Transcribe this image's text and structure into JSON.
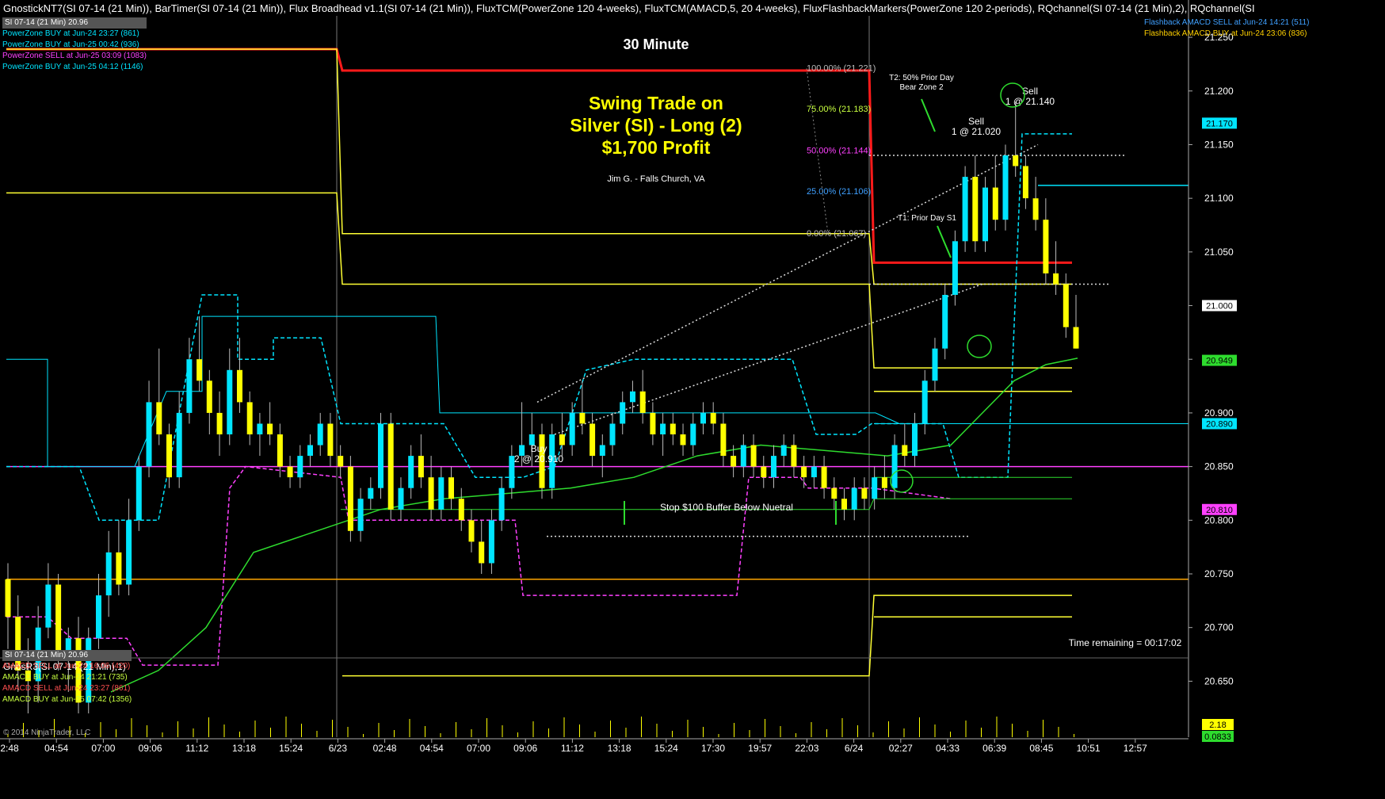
{
  "header": {
    "title": "GnostickNT7(SI 07-14 (21 Min)), BarTimer(SI 07-14 (21 Min)), Flux Broadhead v1.1(SI 07-14 (21 Min)), FluxTCM(PowerZone 120 4-weeks), FluxTCM(AMACD,5, 20 4-weeks), FluxFlashbackMarkers(PowerZone 120 2-periods), RQchannel(SI 07-14 (21 Min),2), RQchannel(SI"
  },
  "legend_top_left": [
    {
      "text": "SI 07-14 (21 Min) 20.96",
      "color": "#ffffff",
      "boxed": true
    },
    {
      "text": "PowerZone BUY at Jun-24 23:27 (861)",
      "color": "#00e5ff"
    },
    {
      "text": "PowerZone BUY at Jun-25 00:42 (936)",
      "color": "#00e5ff"
    },
    {
      "text": "PowerZone SELL at Jun-25 03:09 (1083)",
      "color": "#ff40ff"
    },
    {
      "text": "PowerZone BUY at Jun-25 04:12 (1146)",
      "color": "#00e5ff"
    }
  ],
  "legend_top_right": [
    {
      "text": "Flashback AMACD SELL at Jun-24 14:21 (511)",
      "color": "#3fa0ff"
    },
    {
      "text": "Flashback AMACD BUY at Jun-24 23:06 (836)",
      "color": "#ffd000"
    }
  ],
  "legend_bottom_left": [
    {
      "text": "SI 07-14 (21 Min) 20.96",
      "color": "#ffffff",
      "boxed": true
    },
    {
      "text": "AMACD SELL at Jun-24 16:06 (420)",
      "color": "#ff5050"
    },
    {
      "text": "AMACD BUY at Jun-24 21:21 (735)",
      "color": "#c8ff40"
    },
    {
      "text": "AMACD SELL at Jun-24 23:27 (861)",
      "color": "#ff5050"
    },
    {
      "text": "AMACD BUY at Jun-25 07:42 (1356)",
      "color": "#c8ff40"
    }
  ],
  "annotations": {
    "timeframe": "30 Minute",
    "headline": [
      "Swing Trade on",
      "Silver (SI) - Long (2)",
      "$1,700 Profit"
    ],
    "author": "Jim G. - Falls Church, VA",
    "fib": [
      {
        "label": "100.00% (21.221)",
        "value": 21.221,
        "color": "#bdbdbd"
      },
      {
        "label": "75.00% (21.183)",
        "value": 21.183,
        "color": "#c8ff40"
      },
      {
        "label": "50.00% (21.144)",
        "value": 21.144,
        "color": "#ff40ff"
      },
      {
        "label": "25.00% (21.106)",
        "value": 21.106,
        "color": "#3fa0ff"
      },
      {
        "label": "0.00% (21.067)",
        "value": 21.067,
        "color": "#bdbdbd"
      }
    ],
    "t2": [
      "T2: 50% Prior Day",
      "Bear Zone 2"
    ],
    "t1": "T1: Prior Day S1",
    "sell1": [
      "Sell",
      "1 @ 21.020"
    ],
    "sell2": [
      "Sell",
      "1 @ 21.140"
    ],
    "buy": [
      "Buy",
      "2 @ 20.910"
    ],
    "stop": "Stop $100 Buffer Below Nuetral",
    "time_remaining": "Time remaining = 00:17:02"
  },
  "price_axis": {
    "ticks": [
      "21.250",
      "21.200",
      "21.150",
      "21.100",
      "21.050",
      "21.000",
      "20.950",
      "20.900",
      "20.850",
      "20.800",
      "20.750",
      "20.700",
      "20.650"
    ],
    "tags": [
      {
        "label": "21.170",
        "value": 21.17,
        "color": "#00e5ff"
      },
      {
        "label": "21.000",
        "value": 21.0,
        "color": "#ffffff"
      },
      {
        "label": "20.949",
        "value": 20.949,
        "color": "#2edc2e"
      },
      {
        "label": "20.890",
        "value": 20.89,
        "color": "#00e5ff"
      },
      {
        "label": "20.810",
        "value": 20.81,
        "color": "#ff40ff"
      }
    ]
  },
  "time_axis": {
    "ticks": [
      "2:48",
      "04:54",
      "07:00",
      "09:06",
      "11:12",
      "13:18",
      "15:24",
      "6/23",
      "02:48",
      "04:54",
      "07:00",
      "09:06",
      "11:12",
      "13:18",
      "15:24",
      "17:30",
      "19:57",
      "22:03",
      "6/24",
      "02:27",
      "04:33",
      "06:39",
      "08:45",
      "10:51",
      "12:57"
    ]
  },
  "sub_panel": {
    "title": "GnosR3(SI 07-14 (21 Min),1)",
    "tags": [
      {
        "label": "2.18",
        "color": "#ffff00"
      },
      {
        "label": "0.0833",
        "color": "#2edc2e"
      }
    ]
  },
  "copyright": "© 2014 NinjaTrader, LLC",
  "colors": {
    "up": "#00e5ff",
    "down": "#ffff00",
    "red_level": "#ff1a1a",
    "yellow_level": "#ffff33",
    "orange_level": "#ffa500",
    "ma_green": "#2edc2e",
    "magenta": "#ff40ff",
    "cyan": "#00e5ff"
  },
  "chart_data": {
    "type": "candlestick",
    "symbol": "SI 07-14 (21 Min)",
    "ylim": [
      20.62,
      21.27
    ],
    "bars": [
      [
        20.745,
        20.76,
        20.68,
        20.71
      ],
      [
        20.71,
        20.73,
        20.64,
        20.66
      ],
      [
        20.66,
        20.69,
        20.62,
        20.65
      ],
      [
        20.65,
        20.72,
        20.63,
        20.7
      ],
      [
        20.7,
        20.76,
        20.69,
        20.74
      ],
      [
        20.74,
        20.75,
        20.66,
        20.67
      ],
      [
        20.67,
        20.7,
        20.64,
        20.69
      ],
      [
        20.69,
        20.71,
        20.62,
        20.63
      ],
      [
        20.63,
        20.7,
        20.62,
        20.69
      ],
      [
        20.69,
        20.75,
        20.68,
        20.73
      ],
      [
        20.73,
        20.79,
        20.71,
        20.77
      ],
      [
        20.77,
        20.8,
        20.73,
        20.74
      ],
      [
        20.74,
        20.82,
        20.73,
        20.8
      ],
      [
        20.8,
        20.86,
        20.79,
        20.85
      ],
      [
        20.85,
        20.93,
        20.84,
        20.91
      ],
      [
        20.91,
        20.96,
        20.87,
        20.88
      ],
      [
        20.88,
        20.89,
        20.83,
        20.84
      ],
      [
        20.84,
        20.92,
        20.83,
        20.9
      ],
      [
        20.9,
        20.97,
        20.89,
        20.95
      ],
      [
        20.95,
        20.99,
        20.92,
        20.93
      ],
      [
        20.93,
        20.94,
        20.88,
        20.9
      ],
      [
        20.9,
        20.92,
        20.86,
        20.88
      ],
      [
        20.88,
        20.96,
        20.87,
        20.94
      ],
      [
        20.94,
        20.97,
        20.9,
        20.91
      ],
      [
        20.91,
        20.92,
        20.87,
        20.88
      ],
      [
        20.88,
        20.9,
        20.86,
        20.89
      ],
      [
        20.89,
        20.91,
        20.87,
        20.88
      ],
      [
        20.88,
        20.89,
        20.84,
        20.85
      ],
      [
        20.85,
        20.86,
        20.83,
        20.84
      ],
      [
        20.84,
        20.87,
        20.83,
        20.86
      ],
      [
        20.86,
        20.88,
        20.85,
        20.87
      ],
      [
        20.87,
        20.9,
        20.86,
        20.89
      ],
      [
        20.89,
        20.9,
        20.85,
        20.86
      ],
      [
        20.86,
        20.87,
        20.84,
        20.85
      ],
      [
        20.85,
        20.86,
        20.78,
        20.79
      ],
      [
        20.79,
        20.83,
        20.78,
        20.82
      ],
      [
        20.82,
        20.84,
        20.81,
        20.83
      ],
      [
        20.83,
        20.9,
        20.82,
        20.89
      ],
      [
        20.89,
        20.9,
        20.8,
        20.81
      ],
      [
        20.81,
        20.84,
        20.8,
        20.83
      ],
      [
        20.83,
        20.87,
        20.82,
        20.86
      ],
      [
        20.86,
        20.88,
        20.83,
        20.84
      ],
      [
        20.84,
        20.86,
        20.8,
        20.81
      ],
      [
        20.81,
        20.85,
        20.8,
        20.84
      ],
      [
        20.84,
        20.85,
        20.81,
        20.82
      ],
      [
        20.82,
        20.83,
        20.79,
        20.8
      ],
      [
        20.8,
        20.81,
        20.77,
        20.78
      ],
      [
        20.78,
        20.8,
        20.75,
        20.76
      ],
      [
        20.76,
        20.81,
        20.75,
        20.8
      ],
      [
        20.8,
        20.84,
        20.79,
        20.83
      ],
      [
        20.83,
        20.87,
        20.82,
        20.86
      ],
      [
        20.86,
        20.91,
        20.85,
        20.87
      ],
      [
        20.87,
        20.9,
        20.85,
        20.88
      ],
      [
        20.88,
        20.89,
        20.82,
        20.83
      ],
      [
        20.83,
        20.89,
        20.82,
        20.88
      ],
      [
        20.88,
        20.9,
        20.86,
        20.87
      ],
      [
        20.87,
        20.91,
        20.86,
        20.9
      ],
      [
        20.9,
        20.93,
        20.88,
        20.89
      ],
      [
        20.89,
        20.9,
        20.85,
        20.86
      ],
      [
        20.86,
        20.88,
        20.84,
        20.87
      ],
      [
        20.87,
        20.9,
        20.86,
        20.89
      ],
      [
        20.89,
        20.92,
        20.88,
        20.91
      ],
      [
        20.91,
        20.93,
        20.9,
        20.92
      ],
      [
        20.92,
        20.94,
        20.89,
        20.9
      ],
      [
        20.9,
        20.91,
        20.87,
        20.88
      ],
      [
        20.88,
        20.9,
        20.86,
        20.89
      ],
      [
        20.89,
        20.9,
        20.87,
        20.88
      ],
      [
        20.88,
        20.89,
        20.86,
        20.87
      ],
      [
        20.87,
        20.9,
        20.86,
        20.89
      ],
      [
        20.89,
        20.91,
        20.88,
        20.9
      ],
      [
        20.9,
        20.91,
        20.88,
        20.89
      ],
      [
        20.89,
        20.9,
        20.85,
        20.86
      ],
      [
        20.86,
        20.87,
        20.84,
        20.85
      ],
      [
        20.85,
        20.88,
        20.84,
        20.87
      ],
      [
        20.87,
        20.88,
        20.84,
        20.85
      ],
      [
        20.85,
        20.86,
        20.83,
        20.84
      ],
      [
        20.84,
        20.87,
        20.83,
        20.86
      ],
      [
        20.86,
        20.88,
        20.85,
        20.87
      ],
      [
        20.87,
        20.88,
        20.84,
        20.85
      ],
      [
        20.85,
        20.86,
        20.83,
        20.84
      ],
      [
        20.84,
        20.86,
        20.83,
        20.85
      ],
      [
        20.85,
        20.86,
        20.82,
        20.83
      ],
      [
        20.83,
        20.84,
        20.81,
        20.82
      ],
      [
        20.82,
        20.83,
        20.8,
        20.81
      ],
      [
        20.81,
        20.84,
        20.8,
        20.83
      ],
      [
        20.83,
        20.84,
        20.81,
        20.82
      ],
      [
        20.82,
        20.85,
        20.81,
        20.84
      ],
      [
        20.84,
        20.86,
        20.82,
        20.83
      ],
      [
        20.83,
        20.88,
        20.82,
        20.87
      ],
      [
        20.87,
        20.89,
        20.85,
        20.86
      ],
      [
        20.86,
        20.9,
        20.85,
        20.89
      ],
      [
        20.89,
        20.94,
        20.88,
        20.93
      ],
      [
        20.93,
        20.97,
        20.92,
        20.96
      ],
      [
        20.96,
        21.02,
        20.95,
        21.01
      ],
      [
        21.01,
        21.07,
        21.0,
        21.06
      ],
      [
        21.06,
        21.13,
        21.05,
        21.12
      ],
      [
        21.12,
        21.14,
        21.05,
        21.06
      ],
      [
        21.06,
        21.12,
        21.05,
        21.11
      ],
      [
        21.11,
        21.14,
        21.07,
        21.08
      ],
      [
        21.08,
        21.15,
        21.07,
        21.14
      ],
      [
        21.14,
        21.19,
        21.12,
        21.13
      ],
      [
        21.13,
        21.14,
        21.09,
        21.1
      ],
      [
        21.1,
        21.12,
        21.07,
        21.08
      ],
      [
        21.08,
        21.1,
        21.02,
        21.03
      ],
      [
        21.03,
        21.06,
        21.01,
        21.02
      ],
      [
        21.02,
        21.03,
        20.97,
        20.98
      ],
      [
        20.98,
        21.01,
        20.96,
        20.96
      ]
    ]
  }
}
